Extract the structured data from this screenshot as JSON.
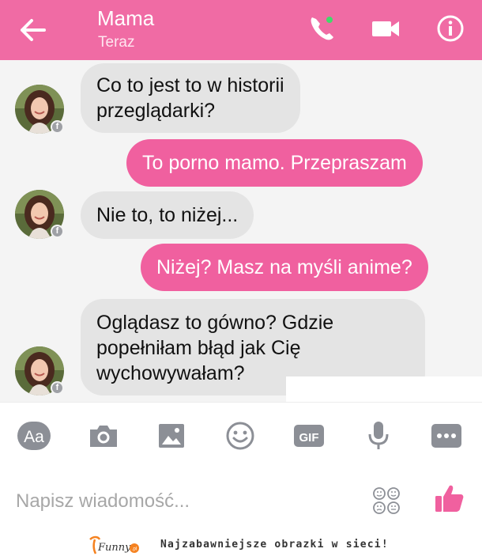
{
  "header": {
    "title": "Mama",
    "subtitle": "Teraz",
    "icons": [
      "back-arrow-icon",
      "phone-call-icon",
      "video-camera-icon",
      "info-icon"
    ]
  },
  "messages": [
    {
      "sender": "contact",
      "lines": [
        "Co to jest to w historii",
        "przeglądarki?"
      ]
    },
    {
      "sender": "me",
      "lines": [
        "To porno mamo. Przepraszam"
      ]
    },
    {
      "sender": "contact",
      "lines": [
        "Nie to, to niżej..."
      ]
    },
    {
      "sender": "me",
      "lines": [
        "Niżej? Masz na myśli anime?"
      ]
    },
    {
      "sender": "contact",
      "lines": [
        "Oglądasz to gówno? Gdzie",
        "popełniłam błąd jak Cię",
        "wychowywałam?"
      ]
    }
  ],
  "toolbar": {
    "aa_label": "Aa",
    "gif_label": "GIF",
    "icons": [
      "text-size-icon",
      "camera-icon",
      "image-icon",
      "emoji-icon",
      "gif-icon",
      "microphone-icon",
      "more-icon"
    ]
  },
  "composer": {
    "placeholder": "Napisz wiadomość..."
  },
  "footer": {
    "logo_text": "Funny",
    "logo_suffix": ".pl",
    "slogan": "Najzabawniejsze obrazki w sieci!"
  },
  "colors": {
    "accent": "#f06ba4",
    "outgoing_bubble": "#f0609f",
    "incoming_bubble": "#e4e4e4",
    "online_dot": "#42d96b",
    "toolbar_icon": "#8c8f96",
    "chat_background": "#f4f4f4"
  }
}
